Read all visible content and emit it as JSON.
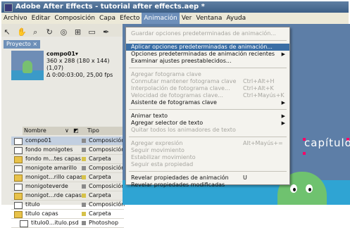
{
  "window": {
    "title": "Adobe After Effects - tutorial after effects.aep *"
  },
  "menubar": {
    "items": [
      "Archivo",
      "Editar",
      "Composición",
      "Capa",
      "Efecto",
      "Animación",
      "Ver",
      "Ventana",
      "Ayuda"
    ],
    "active": "Animación"
  },
  "toolbar": {
    "icons": [
      "selection-tool-icon",
      "hand-tool-icon",
      "zoom-tool-icon",
      "rotate-tool-icon",
      "camera-orbit-icon",
      "pan-behind-icon",
      "shape-tool-icon",
      "pen-tool-icon",
      "text-tool-icon"
    ]
  },
  "project": {
    "tab_label": "Proyecto ×",
    "selected_comp": {
      "name": "compo01▾",
      "info_line1": "360 x 288 (180 x 144) (1,07)",
      "info_line2": "Δ 0:00:03:00, 25,00 fps"
    },
    "columns": {
      "name": "Nombre",
      "type": "Tipo"
    },
    "rows": [
      {
        "name": "compo01",
        "type": "Composición",
        "kind": "comp",
        "selected": true
      },
      {
        "name": "fondo monigotes",
        "type": "Composición",
        "kind": "comp"
      },
      {
        "name": "fondo m...tes capas",
        "type": "Carpeta",
        "kind": "folder"
      },
      {
        "name": "monigote amarillo",
        "type": "Composición",
        "kind": "comp"
      },
      {
        "name": "monigot...rillo capas",
        "type": "Carpeta",
        "kind": "folder"
      },
      {
        "name": "monigoteverde",
        "type": "Composición",
        "kind": "comp"
      },
      {
        "name": "monigot...rde capas",
        "type": "Carpeta",
        "kind": "folder"
      },
      {
        "name": "titulo",
        "type": "Composición",
        "kind": "comp"
      },
      {
        "name": "titulo capas",
        "type": "Carpeta",
        "kind": "folder"
      },
      {
        "name": "titulo0...itulo.psd",
        "type": "Photoshop",
        "kind": "file"
      }
    ]
  },
  "viewer": {
    "title_text": "capítulo"
  },
  "animation_menu": {
    "items": [
      {
        "label": "Guardar opciones predeterminadas de animación...",
        "shortcut": "",
        "state": "disabled",
        "submenu": false
      },
      {
        "label": "Aplicar opciones predeterminadas de animación...",
        "shortcut": "",
        "state": "highlighted",
        "submenu": false
      },
      {
        "label": "Opciones predeterminadas de animación recientes",
        "shortcut": "",
        "state": "enabled",
        "submenu": true
      },
      {
        "label": "Examinar ajustes preestablecidos...",
        "shortcut": "",
        "state": "enabled",
        "submenu": false
      },
      {
        "label": "Agregar fotograma clave",
        "shortcut": "",
        "state": "disabled",
        "submenu": false
      },
      {
        "label": "Conmutar mantener fotograma clave",
        "shortcut": "Ctrl+Alt+H",
        "state": "disabled",
        "submenu": false
      },
      {
        "label": "Interpolación de fotograma clave...",
        "shortcut": "Ctrl+Alt+K",
        "state": "disabled",
        "submenu": false
      },
      {
        "label": "Velocidad de fotogramas clave...",
        "shortcut": "Ctrl+Mayús+K",
        "state": "disabled",
        "submenu": false
      },
      {
        "label": "Asistente de fotogramas clave",
        "shortcut": "",
        "state": "enabled",
        "submenu": true
      },
      {
        "label": "Animar texto",
        "shortcut": "",
        "state": "enabled",
        "submenu": true
      },
      {
        "label": "Agregar selector de texto",
        "shortcut": "",
        "state": "enabled",
        "submenu": true
      },
      {
        "label": "Quitar todos los animadores de texto",
        "shortcut": "",
        "state": "disabled",
        "submenu": false
      },
      {
        "label": "Agregar expresión",
        "shortcut": "Alt+Mayús+=",
        "state": "disabled",
        "submenu": false
      },
      {
        "label": "Seguir movimiento",
        "shortcut": "",
        "state": "disabled",
        "submenu": false
      },
      {
        "label": "Estabilizar movimiento",
        "shortcut": "",
        "state": "disabled",
        "submenu": false
      },
      {
        "label": "Seguir esta propiedad",
        "shortcut": "",
        "state": "disabled",
        "submenu": false
      },
      {
        "label": "Revelar propiedades de animación",
        "shortcut": "U",
        "state": "enabled",
        "submenu": false
      },
      {
        "label": "Revelar propiedades modificadas",
        "shortcut": "",
        "state": "enabled",
        "submenu": false
      }
    ]
  },
  "colors": {
    "title_bar": "#3d5f86",
    "menu_highlight": "#3a6ea5",
    "viewer_bg": "#5d7ea7",
    "figure_green": "#6fc26f"
  }
}
